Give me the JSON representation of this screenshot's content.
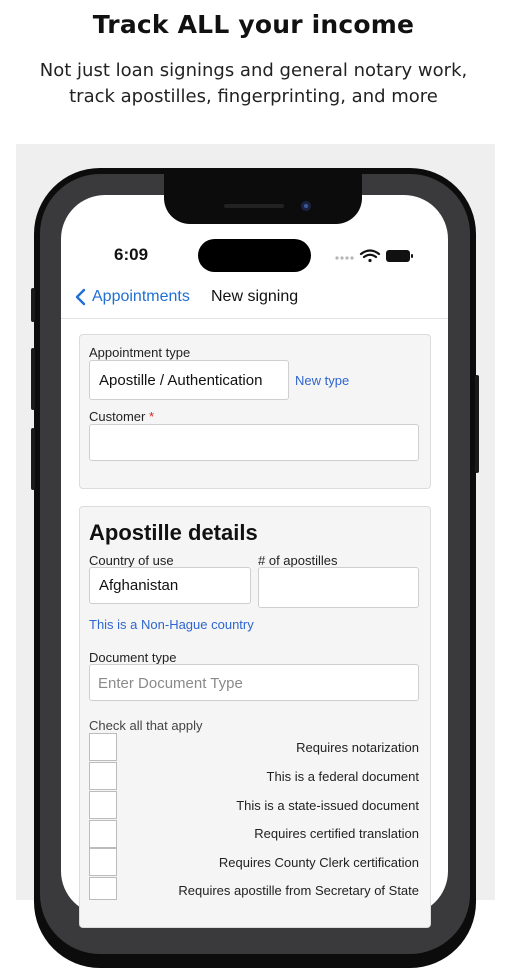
{
  "promo": {
    "headline": "Track ALL your income",
    "subline": "Not just loan signings and general notary work, track apostilles, fingerprinting, and more"
  },
  "status_bar": {
    "time": "6:09"
  },
  "nav": {
    "back_label": "Appointments",
    "title": "New signing"
  },
  "appointment": {
    "type_label": "Appointment type",
    "type_value": "Apostille / Authentication",
    "new_type_link": "New type",
    "customer_label": "Customer",
    "required_marker": "*",
    "customer_value": ""
  },
  "apostille": {
    "title": "Apostille details",
    "country_label": "Country of use",
    "country_value": "Afghanistan",
    "count_label": "# of apostilles",
    "count_value": "",
    "hague_note": "This is a Non-Hague country",
    "doc_type_label": "Document type",
    "doc_type_placeholder": "Enter Document Type",
    "check_all_label": "Check all that apply",
    "checks": [
      "Requires notarization",
      "This is a federal document",
      "This is a state-issued document",
      "Requires certified translation",
      "Requires County Clerk certification",
      "Requires apostille from Secretary of State"
    ]
  },
  "colors": {
    "accent": "#1f6fd6",
    "link": "#2f66cf",
    "required": "#dd2222"
  }
}
